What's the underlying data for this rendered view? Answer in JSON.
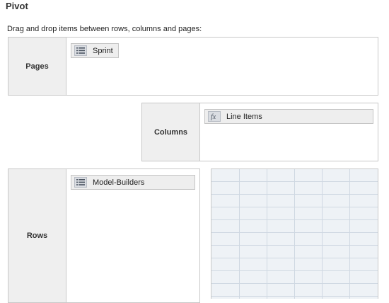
{
  "title": "Pivot",
  "instructions": "Drag and drop items between rows, columns and pages:",
  "zones": {
    "pages": {
      "label": "Pages",
      "items": [
        {
          "label": "Sprint",
          "icon": "list-icon"
        }
      ]
    },
    "columns": {
      "label": "Columns",
      "items": [
        {
          "label": "Line Items",
          "icon": "formula-icon"
        }
      ]
    },
    "rows": {
      "label": "Rows",
      "items": [
        {
          "label": "Model-Builders",
          "icon": "list-icon"
        }
      ]
    }
  },
  "colors": {
    "zone_label_bg": "#efefef",
    "border": "#c8c8c8",
    "chip_bg": "#eeeeee",
    "grid_bg": "#eef2f6",
    "grid_line": "#cfd8e2"
  }
}
